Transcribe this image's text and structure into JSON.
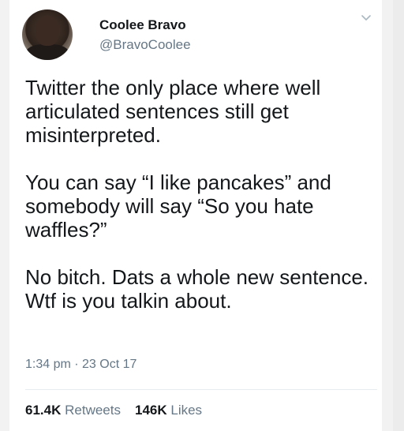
{
  "user": {
    "display_name": "Coolee Bravo",
    "handle": "@BravoCoolee"
  },
  "tweet": {
    "paragraphs": [
      "Twitter the only place where well articulated sentences still get misinterpreted.",
      "You can say “I like pancakes” and somebody will say “So you hate waffles?”",
      "No bitch. Dats a whole new sentence. Wtf is you talkin about."
    ],
    "timestamp": "1:34 pm · 23 Oct 17"
  },
  "stats": {
    "retweets_count": "61.4K",
    "retweets_label": "Retweets",
    "likes_count": "146K",
    "likes_label": "Likes"
  },
  "icons": {
    "menu": "chevron-down-icon"
  },
  "colors": {
    "text": "#14171a",
    "secondary": "#657786",
    "divider": "#e6ecf0"
  }
}
